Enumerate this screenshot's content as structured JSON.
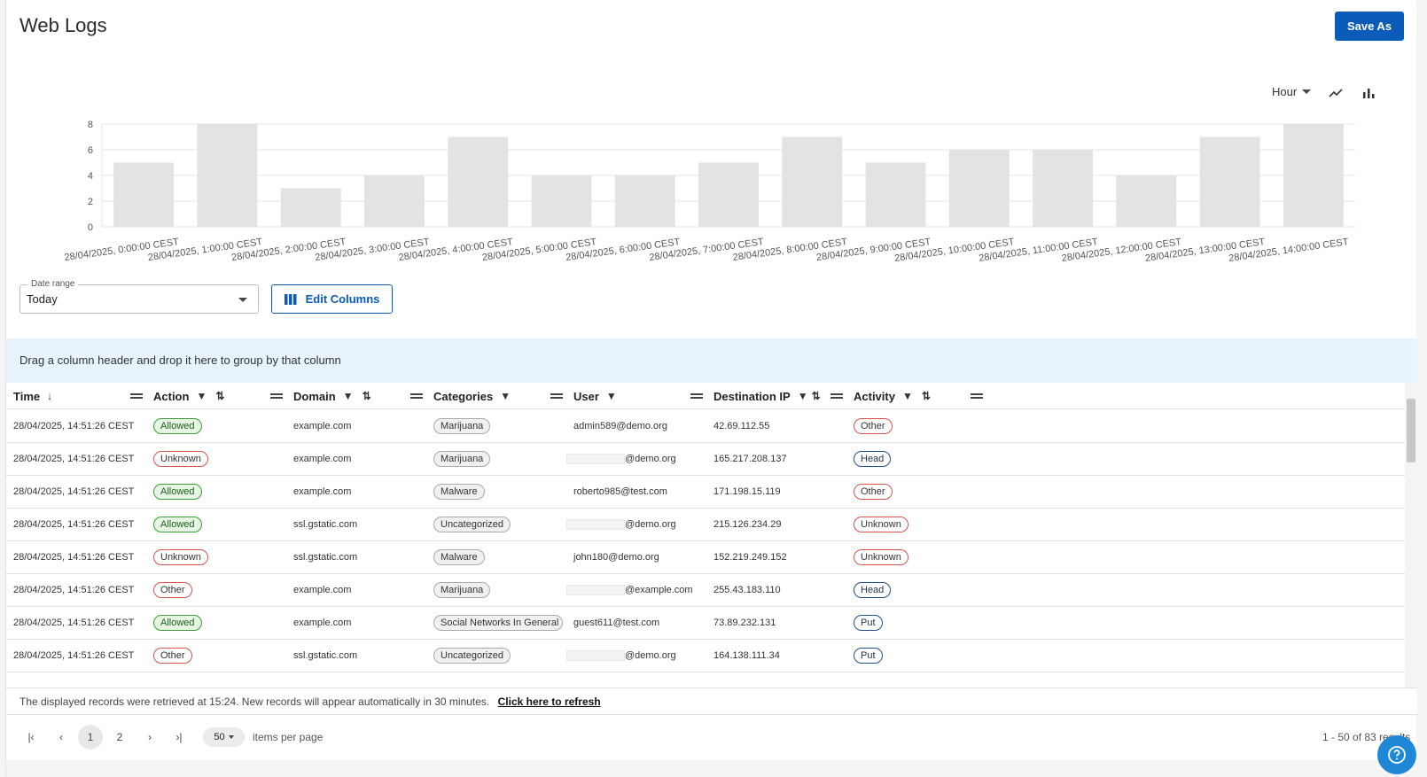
{
  "header": {
    "title": "Web Logs",
    "save_as_label": "Save As"
  },
  "chart_toolbar": {
    "interval": "Hour",
    "line_icon": "line-chart-icon",
    "bar_icon": "bar-chart-icon"
  },
  "chart_data": {
    "type": "bar",
    "categories": [
      "28/04/2025, 0:00:00 CEST",
      "28/04/2025, 1:00:00 CEST",
      "28/04/2025, 2:00:00 CEST",
      "28/04/2025, 3:00:00 CEST",
      "28/04/2025, 4:00:00 CEST",
      "28/04/2025, 5:00:00 CEST",
      "28/04/2025, 6:00:00 CEST",
      "28/04/2025, 7:00:00 CEST",
      "28/04/2025, 8:00:00 CEST",
      "28/04/2025, 9:00:00 CEST",
      "28/04/2025, 10:00:00 CEST",
      "28/04/2025, 11:00:00 CEST",
      "28/04/2025, 12:00:00 CEST",
      "28/04/2025, 13:00:00 CEST",
      "28/04/2025, 14:00:00 CEST"
    ],
    "values": [
      5,
      8,
      3,
      4,
      7,
      4,
      4,
      5,
      7,
      5,
      6,
      6,
      4,
      7,
      8
    ],
    "yticks": [
      "0",
      "2",
      "4",
      "6",
      "8"
    ],
    "ylim": [
      0,
      8
    ],
    "grid": true,
    "bar_color": "#e3e3e3"
  },
  "filters": {
    "date_range_label": "Date range",
    "date_range_value": "Today",
    "edit_columns_label": "Edit Columns"
  },
  "group_bar": {
    "text": "Drag a column header and drop it here to group by that column"
  },
  "columns": [
    "Time",
    "Action",
    "Domain",
    "Categories",
    "User",
    "Destination IP",
    "Activity"
  ],
  "rows": [
    {
      "time": "28/04/2025, 14:51:26 CEST",
      "action": "Allowed",
      "action_kind": "green",
      "domain": "example.com",
      "category": "Marijuana",
      "user": "admin589@demo.org",
      "user_redacted": false,
      "ip": "42.69.112.55",
      "activity": "Other",
      "activity_kind": "red"
    },
    {
      "time": "28/04/2025, 14:51:26 CEST",
      "action": "Unknown",
      "action_kind": "red",
      "domain": "example.com",
      "category": "Marijuana",
      "user": "@demo.org",
      "user_redacted": true,
      "ip": "165.217.208.137",
      "activity": "Head",
      "activity_kind": "blue"
    },
    {
      "time": "28/04/2025, 14:51:26 CEST",
      "action": "Allowed",
      "action_kind": "green",
      "domain": "example.com",
      "category": "Malware",
      "user": "roberto985@test.com",
      "user_redacted": false,
      "ip": "171.198.15.119",
      "activity": "Other",
      "activity_kind": "red"
    },
    {
      "time": "28/04/2025, 14:51:26 CEST",
      "action": "Allowed",
      "action_kind": "green",
      "domain": "ssl.gstatic.com",
      "category": "Uncategorized",
      "user": "@demo.org",
      "user_redacted": true,
      "ip": "215.126.234.29",
      "activity": "Unknown",
      "activity_kind": "red"
    },
    {
      "time": "28/04/2025, 14:51:26 CEST",
      "action": "Unknown",
      "action_kind": "red",
      "domain": "ssl.gstatic.com",
      "category": "Malware",
      "user": "john180@demo.org",
      "user_redacted": false,
      "ip": "152.219.249.152",
      "activity": "Unknown",
      "activity_kind": "red"
    },
    {
      "time": "28/04/2025, 14:51:26 CEST",
      "action": "Other",
      "action_kind": "red",
      "domain": "example.com",
      "category": "Marijuana",
      "user": "@example.com",
      "user_redacted": true,
      "ip": "255.43.183.110",
      "activity": "Head",
      "activity_kind": "blue"
    },
    {
      "time": "28/04/2025, 14:51:26 CEST",
      "action": "Allowed",
      "action_kind": "green",
      "domain": "example.com",
      "category": "Social Networks In General",
      "user": "guest611@test.com",
      "user_redacted": false,
      "ip": "73.89.232.131",
      "activity": "Put",
      "activity_kind": "blue"
    },
    {
      "time": "28/04/2025, 14:51:26 CEST",
      "action": "Other",
      "action_kind": "red",
      "domain": "ssl.gstatic.com",
      "category": "Uncategorized",
      "user": "@demo.org",
      "user_redacted": true,
      "ip": "164.138.111.34",
      "activity": "Put",
      "activity_kind": "blue"
    }
  ],
  "footer": {
    "note": "The displayed records were retrieved at 15:24. New records will appear automatically in 30 minutes.",
    "refresh_label": "Click here to refresh"
  },
  "pagination": {
    "pages": [
      "1",
      "2"
    ],
    "current": "1",
    "per_page": "50",
    "per_page_label": "items per page",
    "range_text": "1 - 50 of 83 results"
  },
  "colors": {
    "accent": "#0b5cb8",
    "group_bar_bg": "#e8f4fd",
    "allowed_bg": "#e6f5e4",
    "danger": "#d9534f",
    "help_bg": "#1e88d6"
  }
}
